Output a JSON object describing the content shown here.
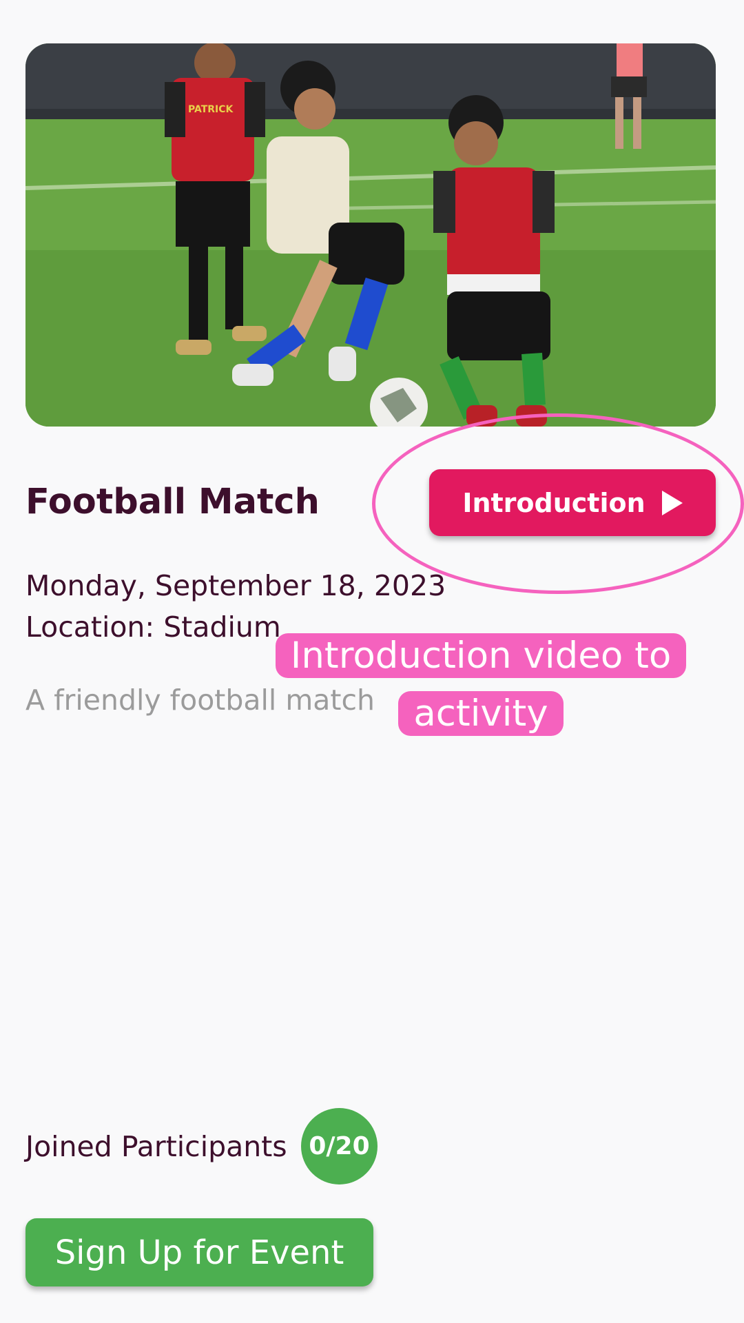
{
  "event": {
    "title": "Football Match",
    "date": "Monday, September 18, 2023",
    "location": "Location: Stadium",
    "description": "A friendly football match"
  },
  "intro_button": {
    "label": "Introduction",
    "icon": "play-icon"
  },
  "annotation": {
    "line1": "Introduction video to",
    "line2": "activity",
    "color": "#f562be"
  },
  "participants": {
    "label": "Joined Participants",
    "count": "0/20"
  },
  "signup_button": {
    "label": "Sign Up for Event"
  },
  "hero_image": {
    "jersey_text": "PATRICK"
  },
  "colors": {
    "primary": "#e2195f",
    "success": "#4caf50",
    "text": "#3d0f2c",
    "muted": "#9b9b9b"
  }
}
